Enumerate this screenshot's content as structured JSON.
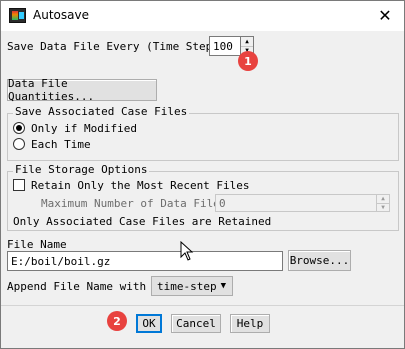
{
  "window": {
    "title": "Autosave",
    "close_glyph": "✕",
    "icon": "app-icon"
  },
  "save_every": {
    "label": "Save Data File Every (Time Steps)",
    "value": "100",
    "badge": "1"
  },
  "quantities_button": "Data File Quantities...",
  "case_files": {
    "title": "Save Associated Case Files",
    "options": [
      "Only if Modified",
      "Each Time"
    ],
    "selected": "Only if Modified"
  },
  "storage": {
    "title": "File Storage Options",
    "retain_label": "Retain Only the Most Recent Files",
    "retain_checked": false,
    "max_label": "Maximum Number of Data Files",
    "max_value": "0",
    "note": "Only Associated Case Files are Retained"
  },
  "file_name": {
    "label": "File Name",
    "value": "E:/boil/boil.gz",
    "browse_label": "Browse..."
  },
  "append": {
    "label": "Append File Name with",
    "value": "time-step"
  },
  "footer": {
    "badge": "2",
    "ok": "OK",
    "cancel": "Cancel",
    "help": "Help"
  },
  "colors": {
    "badge": "#e8423f",
    "default_border": "#0078d7"
  }
}
